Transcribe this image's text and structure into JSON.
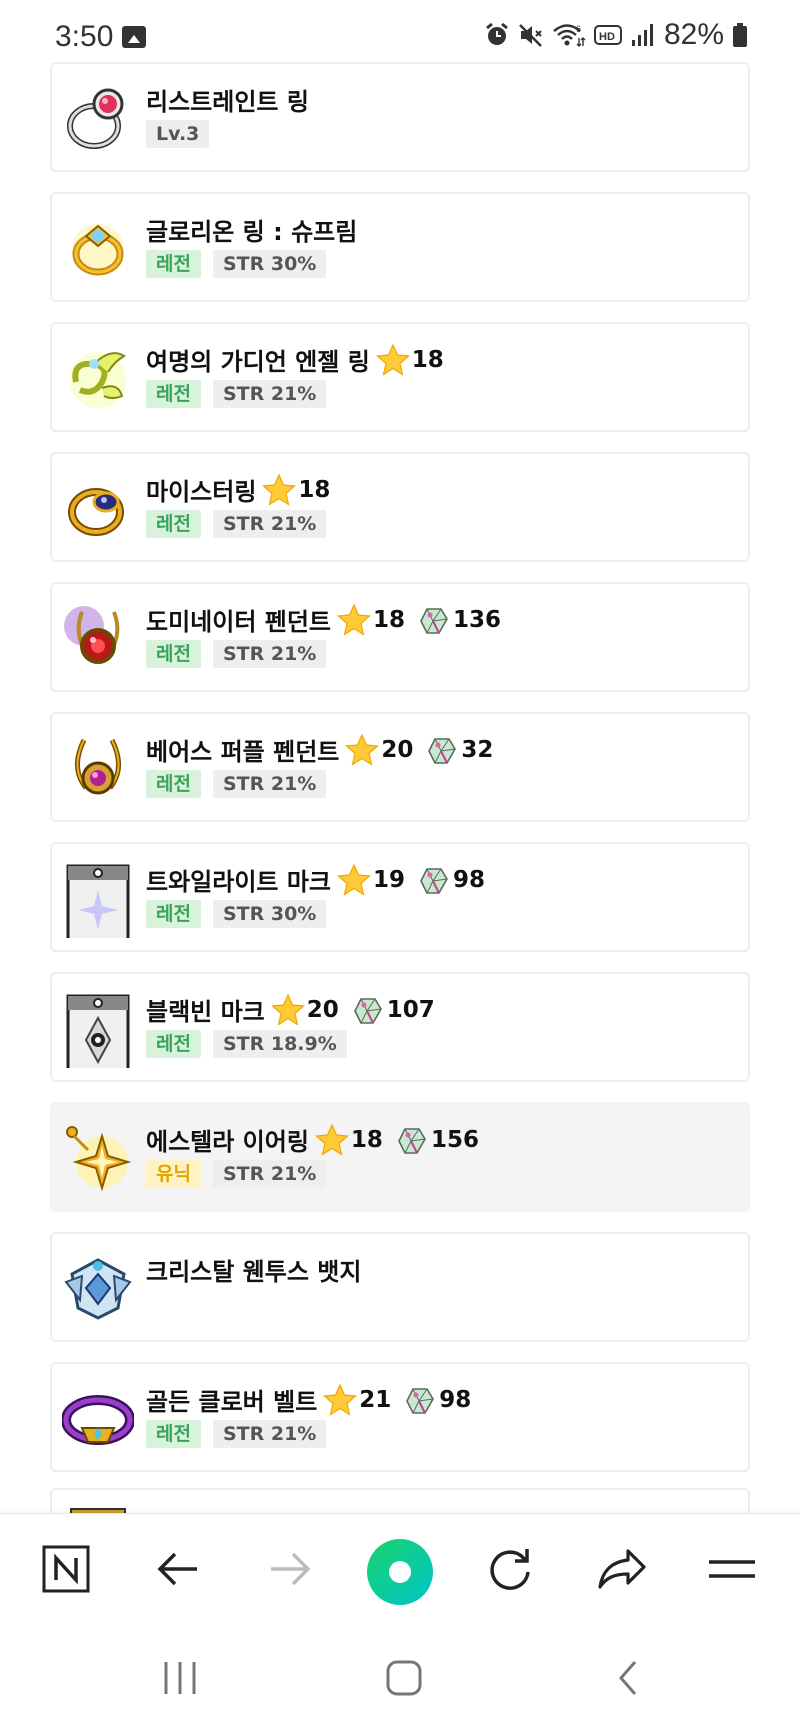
{
  "status_bar": {
    "time": "3:50",
    "battery": "82%"
  },
  "items": [
    {
      "name": "리스트레인트 링",
      "icon": "ring-red-icon",
      "badges": [
        {
          "text": "Lv.3",
          "kind": "gray"
        }
      ]
    },
    {
      "name": "글로리온 링 : 슈프림",
      "icon": "ring-gold-icon",
      "badges": [
        {
          "text": "레전",
          "kind": "legend"
        },
        {
          "text": "STR 30%",
          "kind": "gray"
        }
      ]
    },
    {
      "name": "여명의 가디언 엔젤 링",
      "icon": "ring-angel-icon",
      "star": "18",
      "badges": [
        {
          "text": "레전",
          "kind": "legend"
        },
        {
          "text": "STR 21%",
          "kind": "gray"
        }
      ]
    },
    {
      "name": "마이스터링",
      "icon": "ring-meister-icon",
      "star": "18",
      "badges": [
        {
          "text": "레전",
          "kind": "legend"
        },
        {
          "text": "STR 21%",
          "kind": "gray"
        }
      ]
    },
    {
      "name": "도미네이터 펜던트",
      "icon": "pendant-dominator-icon",
      "star": "18",
      "gem": "136",
      "badges": [
        {
          "text": "레전",
          "kind": "legend"
        },
        {
          "text": "STR 21%",
          "kind": "gray"
        }
      ]
    },
    {
      "name": "베어스 퍼플 펜던트",
      "icon": "pendant-purple-icon",
      "star": "20",
      "gem": "32",
      "badges": [
        {
          "text": "레전",
          "kind": "legend"
        },
        {
          "text": "STR 21%",
          "kind": "gray"
        }
      ]
    },
    {
      "name": "트와일라이트 마크",
      "icon": "mark-twilight-icon",
      "star": "19",
      "gem": "98",
      "badges": [
        {
          "text": "레전",
          "kind": "legend"
        },
        {
          "text": "STR 30%",
          "kind": "gray"
        }
      ]
    },
    {
      "name": "블랙빈 마크",
      "icon": "mark-blackbean-icon",
      "star": "20",
      "gem": "107",
      "badges": [
        {
          "text": "레전",
          "kind": "legend"
        },
        {
          "text": "STR 18.9%",
          "kind": "gray"
        }
      ]
    },
    {
      "name": "에스텔라 이어링",
      "icon": "earring-estella-icon",
      "star": "18",
      "gem": "156",
      "highlight": true,
      "badges": [
        {
          "text": "유닉",
          "kind": "unique"
        },
        {
          "text": "STR 21%",
          "kind": "gray"
        }
      ]
    },
    {
      "name": "크리스탈 웬투스 뱃지",
      "icon": "badge-crystal-icon",
      "badges": []
    },
    {
      "name": "골든 클로버 벨트",
      "icon": "belt-clover-icon",
      "star": "21",
      "gem": "98",
      "badges": [
        {
          "text": "레전",
          "kind": "legend"
        },
        {
          "text": "STR 21%",
          "kind": "gray"
        }
      ]
    }
  ],
  "toolbar": {
    "buttons": [
      "naver-n-icon",
      "back-arrow-icon",
      "forward-arrow-icon",
      "home-icon",
      "refresh-icon",
      "share-icon",
      "menu-icon"
    ]
  },
  "system_nav": {
    "buttons": [
      "recents-icon",
      "home-square-icon",
      "back-chevron-icon"
    ]
  }
}
